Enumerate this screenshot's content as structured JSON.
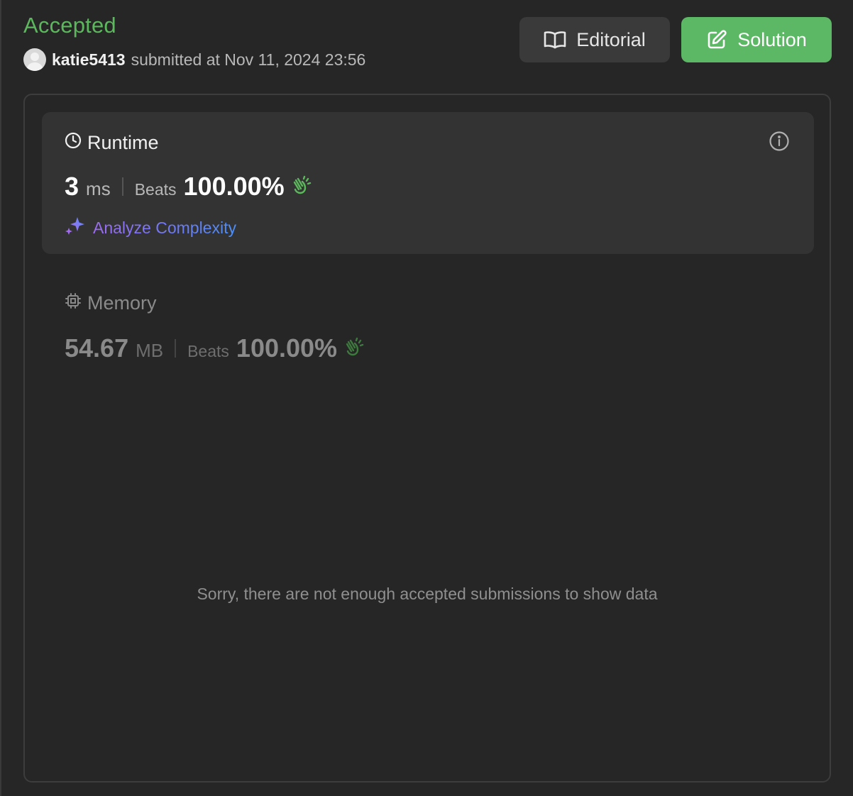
{
  "result": {
    "status": "Accepted",
    "status_color": "#5cb85c",
    "username": "katie5413",
    "submitted_text": "submitted at Nov 11, 2024 23:56"
  },
  "actions": {
    "editorial_label": "Editorial",
    "editorial_icon": "book-open-icon",
    "solution_label": "Solution",
    "solution_icon": "edit-icon",
    "solution_color": "#5cb865"
  },
  "runtime": {
    "title": "Runtime",
    "icon": "clock-icon",
    "value": "3",
    "unit": "ms",
    "beats_label": "Beats",
    "beats_value": "100.00%",
    "beats_icon": "clapping-hands-icon",
    "analyze_label": "Analyze Complexity",
    "analyze_icon": "sparkle-icon"
  },
  "memory": {
    "title": "Memory",
    "icon": "cpu-icon",
    "value": "54.67",
    "unit": "MB",
    "beats_label": "Beats",
    "beats_value": "100.00%",
    "beats_icon": "clapping-hands-icon"
  },
  "chart": {
    "empty_message": "Sorry, there are not enough accepted submissions to show data"
  }
}
